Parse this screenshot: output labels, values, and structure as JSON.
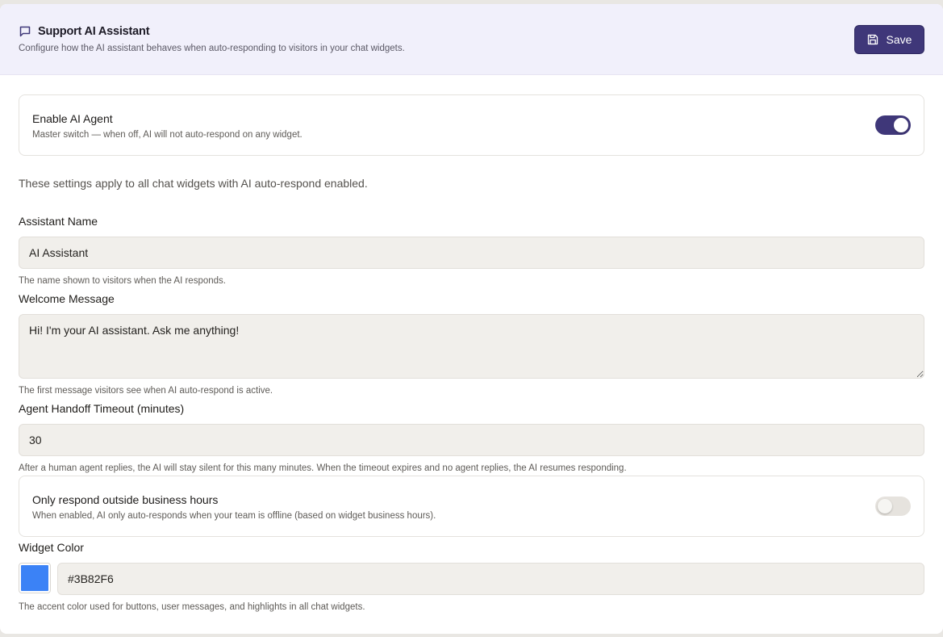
{
  "header": {
    "title": "Support AI Assistant",
    "description": "Configure how the AI assistant behaves when auto-responding to visitors in your chat widgets.",
    "save_label": "Save",
    "icon": "chat-bubble-icon"
  },
  "enable_agent": {
    "title": "Enable AI Agent",
    "description": "Master switch — when off, AI will not auto-respond on any widget.",
    "enabled": true
  },
  "info_text": "These settings apply to all chat widgets with AI auto-respond enabled.",
  "assistant_name": {
    "label": "Assistant Name",
    "value": "AI Assistant",
    "help": "The name shown to visitors when the AI responds."
  },
  "welcome_message": {
    "label": "Welcome Message",
    "value": "Hi! I'm your AI assistant. Ask me anything!",
    "help": "The first message visitors see when AI auto-respond is active."
  },
  "handoff_timeout": {
    "label": "Agent Handoff Timeout (minutes)",
    "value": "30",
    "help": "After a human agent replies, the AI will stay silent for this many minutes. When the timeout expires and no agent replies, the AI resumes responding."
  },
  "business_hours": {
    "title": "Only respond outside business hours",
    "description": "When enabled, AI only auto-responds when your team is offline (based on widget business hours).",
    "enabled": false
  },
  "widget_color": {
    "label": "Widget Color",
    "value": "#3B82F6",
    "help": "The accent color used for buttons, user messages, and highlights in all chat widgets."
  },
  "colors": {
    "accent": "#3f3779",
    "header_bg": "#f1f0fb",
    "input_bg": "#f1efeb",
    "widget_swatch": "#3B82F6"
  }
}
